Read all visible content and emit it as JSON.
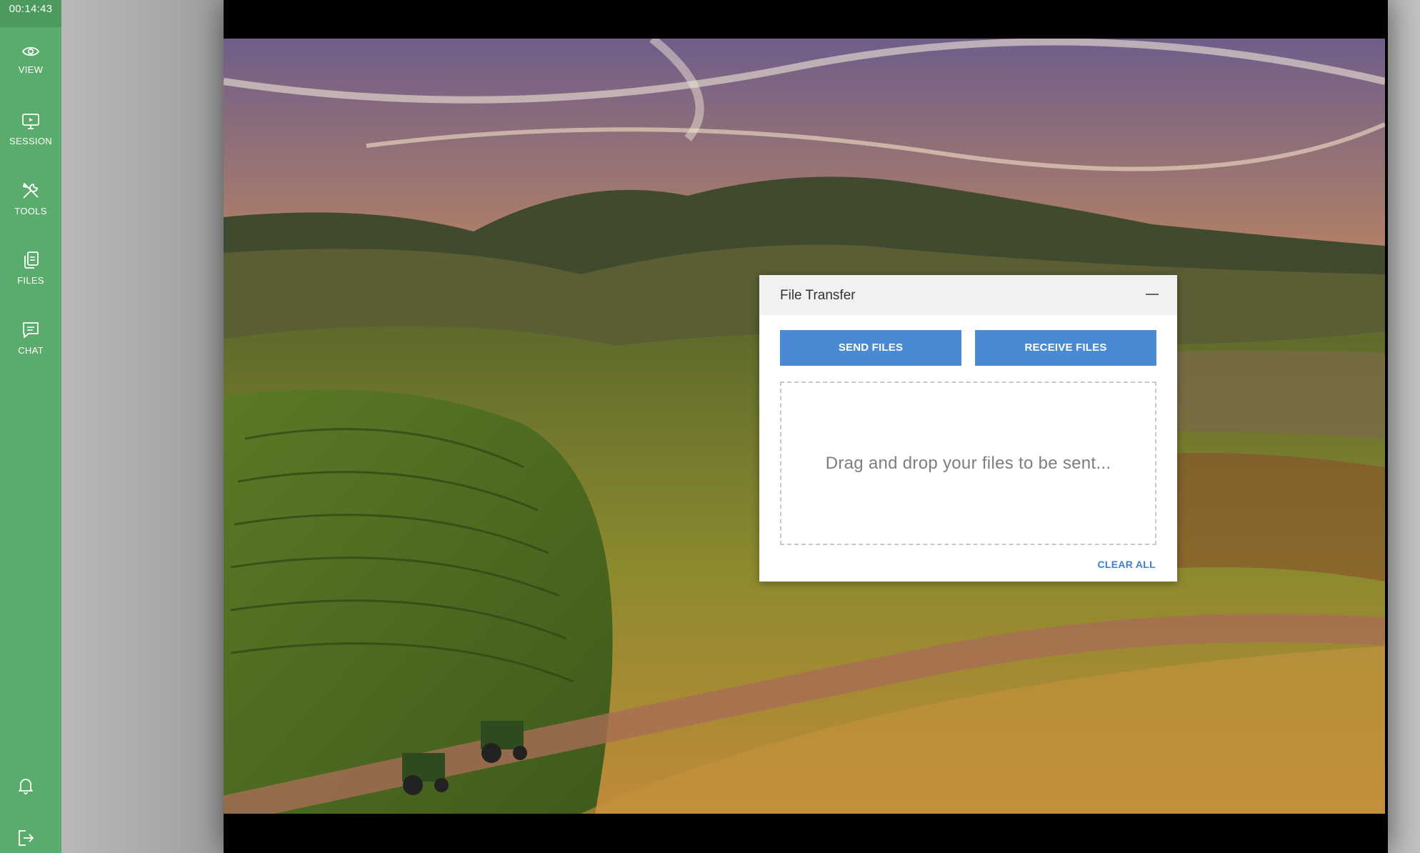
{
  "sidebar": {
    "timer": "00:14:43",
    "items": [
      {
        "label": "VIEW",
        "icon": "eye-icon"
      },
      {
        "label": "SESSION",
        "icon": "monitor-icon"
      },
      {
        "label": "TOOLS",
        "icon": "tools-icon"
      },
      {
        "label": "FILES",
        "icon": "files-icon"
      },
      {
        "label": "CHAT",
        "icon": "chat-icon"
      }
    ],
    "bottom_icons": [
      "bell-icon",
      "logout-icon"
    ],
    "color": "#5aac6c"
  },
  "dialog": {
    "title": "File Transfer",
    "send_label": "SEND FILES",
    "receive_label": "RECEIVE FILES",
    "dropzone_text": "Drag and drop your files to be sent...",
    "clear_label": "CLEAR ALL",
    "button_color": "#4a8ad3"
  },
  "floating_logo": {
    "icon": "app-logo-icon"
  }
}
